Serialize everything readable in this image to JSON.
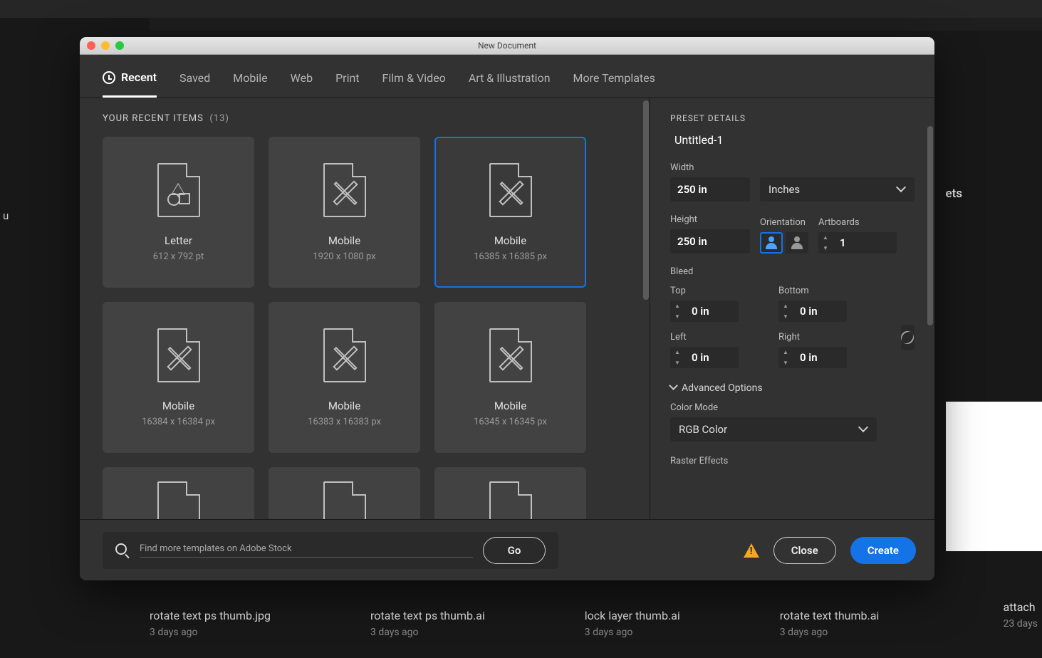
{
  "window": {
    "title": "New Document"
  },
  "tabs": [
    "Recent",
    "Saved",
    "Mobile",
    "Web",
    "Print",
    "Film & Video",
    "Art & Illustration",
    "More Templates"
  ],
  "section": {
    "title": "YOUR RECENT ITEMS",
    "count": "(13)"
  },
  "cards": [
    {
      "title": "Letter",
      "sub": "612 x 792 pt",
      "icon": "shapes"
    },
    {
      "title": "Mobile",
      "sub": "1920 x 1080 px",
      "icon": "tools"
    },
    {
      "title": "Mobile",
      "sub": "16385 x 16385 px",
      "icon": "tools",
      "selected": true
    },
    {
      "title": "Mobile",
      "sub": "16384 x 16384 px",
      "icon": "tools"
    },
    {
      "title": "Mobile",
      "sub": "16383 x 16383 px",
      "icon": "tools"
    },
    {
      "title": "Mobile",
      "sub": "16345 x 16345 px",
      "icon": "tools"
    }
  ],
  "preset": {
    "header": "PRESET DETAILS",
    "name": "Untitled-1",
    "width_label": "Width",
    "width": "250 in",
    "units": "Inches",
    "height_label": "Height",
    "height": "250 in",
    "orientation_label": "Orientation",
    "artboards_label": "Artboards",
    "artboards": "1",
    "bleed_label": "Bleed",
    "top_label": "Top",
    "top": "0 in",
    "bottom_label": "Bottom",
    "bottom": "0 in",
    "left_label": "Left",
    "left": "0 in",
    "right_label": "Right",
    "right": "0 in",
    "advanced": "Advanced Options",
    "color_mode_label": "Color Mode",
    "color_mode": "RGB Color",
    "raster_label": "Raster Effects"
  },
  "search": {
    "placeholder": "Find more templates on Adobe Stock",
    "go": "Go"
  },
  "buttons": {
    "close": "Close",
    "create": "Create"
  },
  "bg_files": [
    {
      "name": "rotate text ps thumb.jpg",
      "sub": "3 days ago"
    },
    {
      "name": "rotate text ps thumb.ai",
      "sub": "3 days ago"
    },
    {
      "name": "lock layer thumb.ai",
      "sub": "3 days ago"
    },
    {
      "name": "rotate text thumb.ai",
      "sub": "3 days ago"
    }
  ],
  "bg_right": {
    "name": "attach",
    "sub": "23 days"
  },
  "bg_side": {
    "a": "u",
    "b": "ets"
  }
}
